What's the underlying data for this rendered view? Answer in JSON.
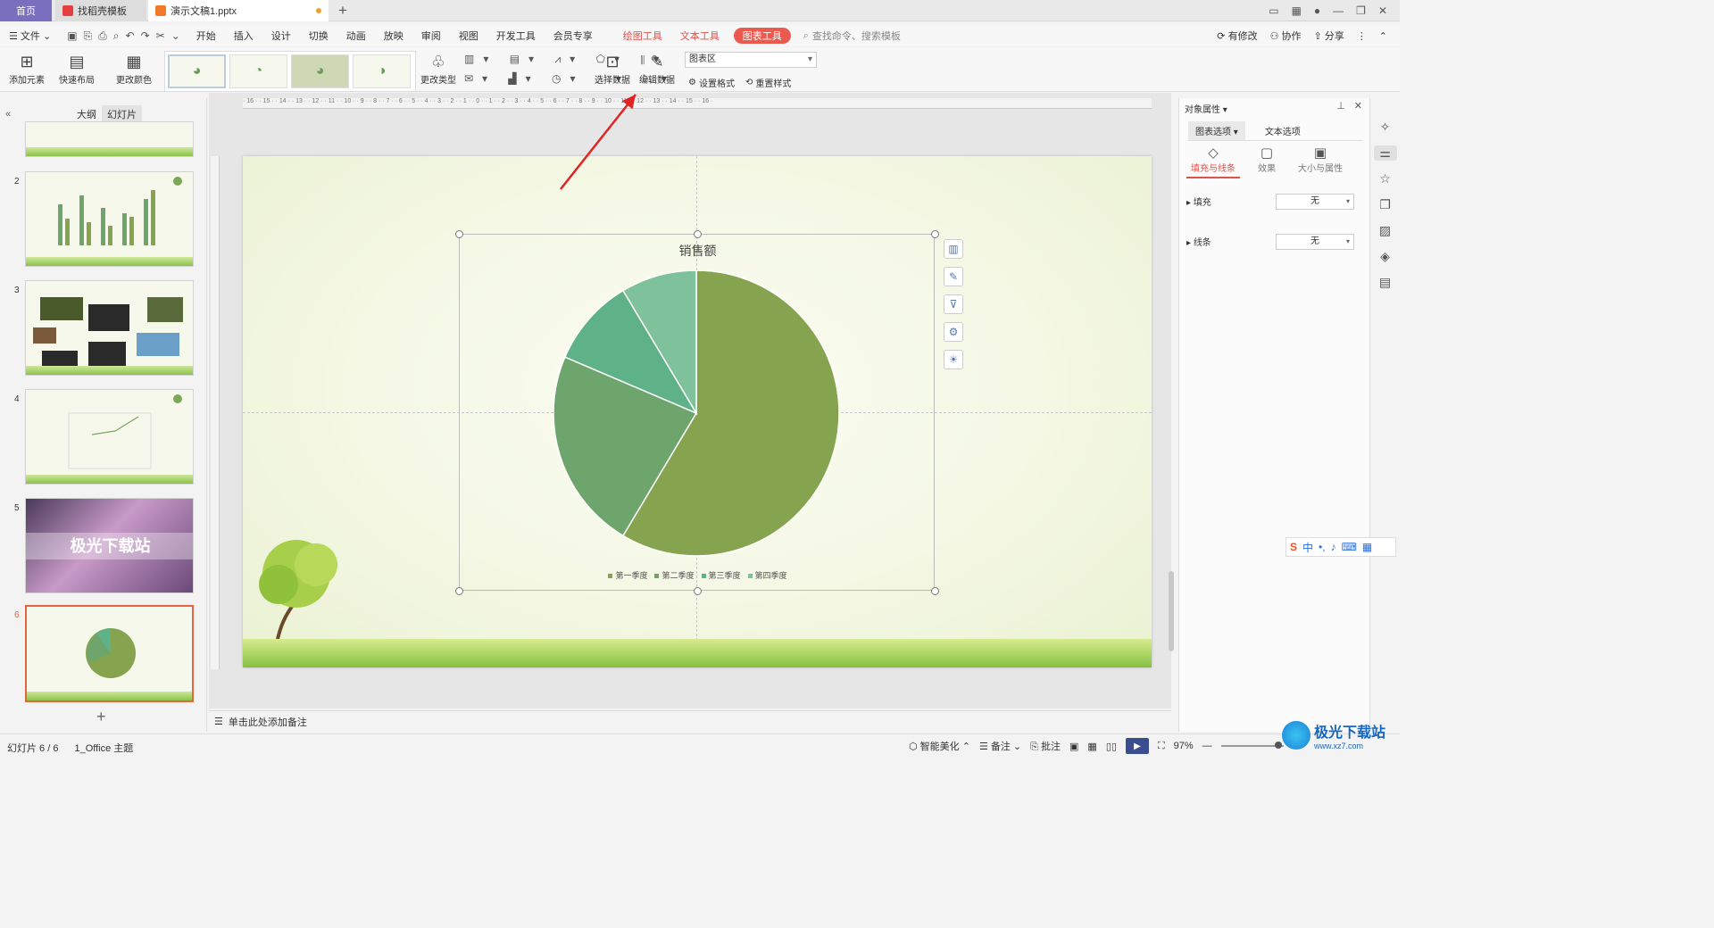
{
  "tabs": {
    "home": "首页",
    "template": "找稻壳模板",
    "doc": "演示文稿1.pptx",
    "plus": "+"
  },
  "window_icons": [
    "layout-icon",
    "grid-icon",
    "user-icon",
    "minimize-icon",
    "restore-icon",
    "close-icon"
  ],
  "menu": {
    "file": "文件",
    "items": [
      "开始",
      "插入",
      "设计",
      "切换",
      "动画",
      "放映",
      "审阅",
      "视图",
      "开发工具",
      "会员专享"
    ],
    "ctx": [
      "绘图工具",
      "文本工具"
    ],
    "active": "图表工具",
    "search": "查找命令、搜索模板",
    "right": [
      "有修改",
      "协作",
      "分享"
    ]
  },
  "ribbon": {
    "add_element": "添加元素",
    "quick_layout": "快速布局",
    "change_color": "更改颜色",
    "change_type": "更改类型",
    "select_data": "选择数据",
    "edit_data": "编辑数据",
    "chart_area": "图表区",
    "set_format": "设置格式",
    "reset_style": "重置样式"
  },
  "left_panel": {
    "outline": "大纲",
    "slides": "幻灯片",
    "numbers": [
      "2",
      "3",
      "4",
      "5",
      "6"
    ],
    "slide5_text": "极光下载站"
  },
  "chart": {
    "title": "销售额",
    "colors": {
      "q1": "#86a350",
      "q2": "#6da56c",
      "q3": "#5fb187",
      "q4": "#7fc19a"
    }
  },
  "chart_data": {
    "type": "pie",
    "title": "销售额",
    "categories": [
      "第一季度",
      "第二季度",
      "第三季度",
      "第四季度"
    ],
    "values": [
      8.2,
      3.2,
      1.4,
      1.2
    ],
    "legend": "bottom"
  },
  "notes": "单击此处添加备注",
  "right_panel": {
    "title": "对象属性",
    "tabs": [
      "图表选项",
      "文本选项"
    ],
    "sub": [
      "填充与线条",
      "效果",
      "大小与属性"
    ],
    "fill_label": "填充",
    "fill_value": "无",
    "line_label": "线条",
    "line_value": "无"
  },
  "status": {
    "slide": "幻灯片 6 / 6",
    "theme": "1_Office 主题",
    "beautify": "智能美化",
    "notes": "备注",
    "comments": "批注",
    "zoom": "97%"
  },
  "ime": {
    "lang": "中"
  },
  "watermark": {
    "title": "极光下载站",
    "url": "www.xz7.com"
  }
}
